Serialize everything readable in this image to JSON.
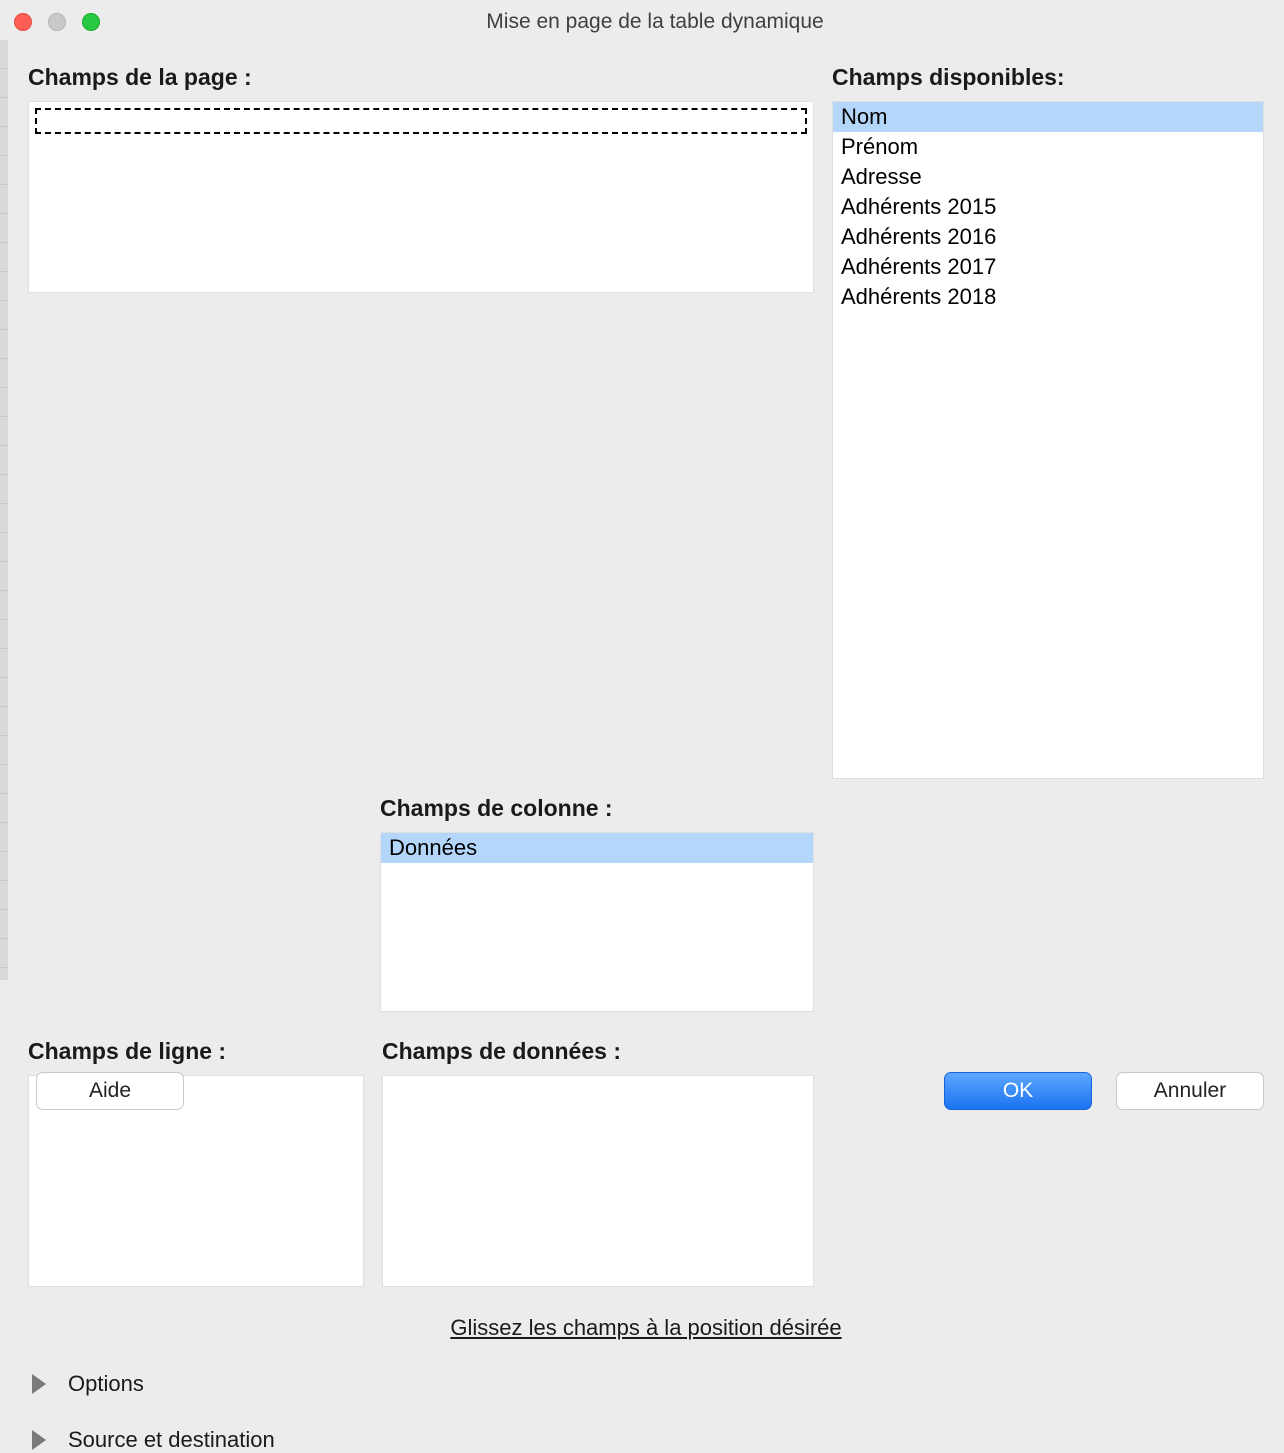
{
  "window": {
    "title": "Mise en page de la table dynamique"
  },
  "labels": {
    "page_fields": "Champs de la page :",
    "available_fields": "Champs disponibles:",
    "column_fields": "Champs de colonne :",
    "row_fields": "Champs de ligne :",
    "data_fields": "Champs de données :",
    "hint": "Glissez les champs à la position désirée"
  },
  "available_fields": [
    {
      "label": "Nom",
      "selected": true
    },
    {
      "label": "Prénom",
      "selected": false
    },
    {
      "label": "Adresse",
      "selected": false
    },
    {
      "label": "Adhérents 2015",
      "selected": false
    },
    {
      "label": "Adhérents 2016",
      "selected": false
    },
    {
      "label": "Adhérents 2017",
      "selected": false
    },
    {
      "label": "Adhérents 2018",
      "selected": false
    }
  ],
  "column_fields": [
    {
      "label": "Données",
      "selected": true
    }
  ],
  "page_fields": [],
  "row_fields": [],
  "data_fields": [],
  "expanders": {
    "options": "Options",
    "source_dest": "Source et destination"
  },
  "buttons": {
    "help": "Aide",
    "ok": "OK",
    "cancel": "Annuler"
  }
}
